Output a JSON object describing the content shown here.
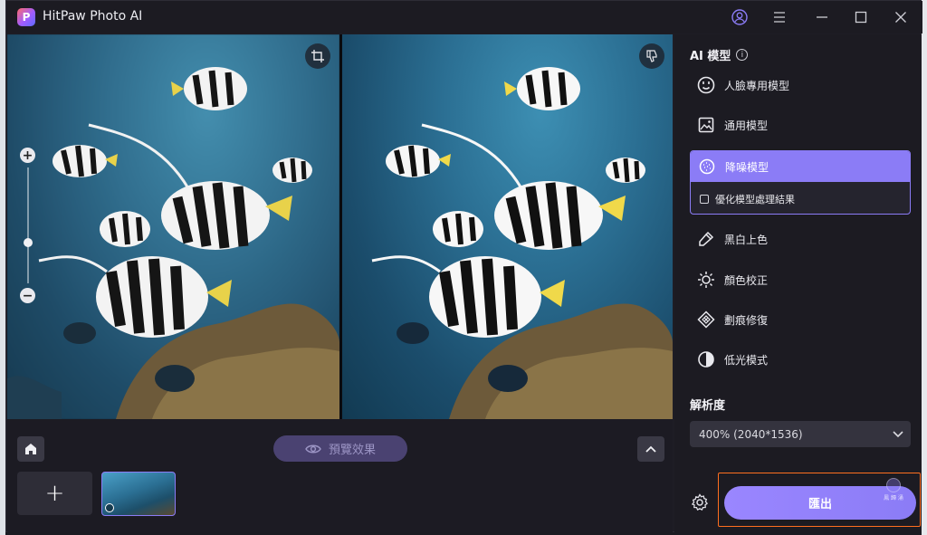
{
  "app": {
    "title": "HitPaw Photo AI",
    "logo_letter": "P"
  },
  "titlebar": {
    "icons": [
      "user-icon",
      "menu-icon",
      "minimize-icon",
      "maximize-icon",
      "close-icon"
    ]
  },
  "preview": {
    "zoom_level_fraction": 0.35
  },
  "bottom": {
    "preview_label": "預覽效果",
    "add_label": "+"
  },
  "panel": {
    "title": "AI 模型",
    "models": [
      {
        "label": "人臉專用模型",
        "icon": "face-icon",
        "selected": false
      },
      {
        "label": "通用模型",
        "icon": "image-icon",
        "selected": false
      },
      {
        "label": "降噪模型",
        "icon": "denoise-icon",
        "selected": true,
        "option_label": "優化模型處理結果",
        "option_checked": false
      },
      {
        "label": "黑白上色",
        "icon": "colorize-icon",
        "selected": false
      },
      {
        "label": "顏色校正",
        "icon": "color-correct-icon",
        "selected": false
      },
      {
        "label": "劃痕修復",
        "icon": "scratch-repair-icon",
        "selected": false
      },
      {
        "label": "低光模式",
        "icon": "low-light-icon",
        "selected": false
      }
    ],
    "resolution_title": "解析度",
    "resolution_value": "400% (2040*1536)",
    "export_label": "匯出",
    "watermark_text": "鳳 歸 涌"
  },
  "colors": {
    "accent": "#8b7cf6",
    "highlight_frame": "#ff6f1f"
  }
}
